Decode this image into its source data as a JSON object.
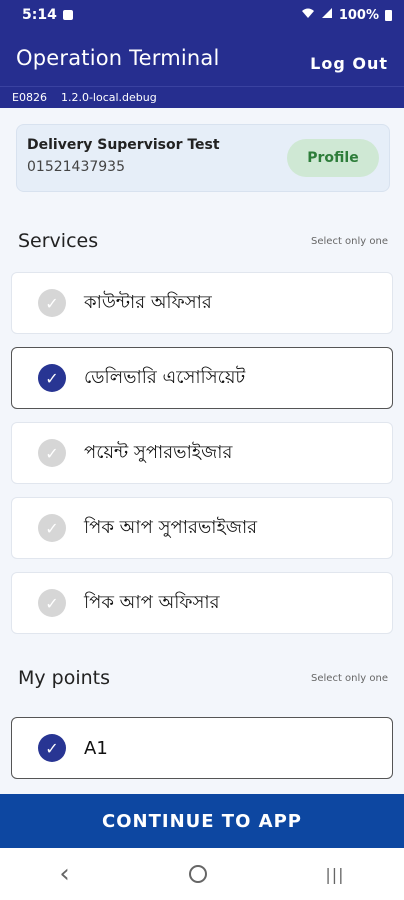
{
  "status_bar": {
    "time": "5:14",
    "battery": "100%"
  },
  "app_bar": {
    "title": "Operation Terminal",
    "logout_label": "Log Out"
  },
  "version": {
    "id": "E0826",
    "build": "1.2.0-local.debug"
  },
  "profile": {
    "name": "Delivery Supervisor Test",
    "phone": "01521437935",
    "button_label": "Profile"
  },
  "services": {
    "title": "Services",
    "hint": "Select only one",
    "items": [
      {
        "label": "কাউন্টার অফিসার",
        "selected": false
      },
      {
        "label": "ডেলিভারি এসোসিয়েট",
        "selected": true
      },
      {
        "label": "পয়েন্ট সুপারভাইজার",
        "selected": false
      },
      {
        "label": "পিক আপ সুপারভাইজার",
        "selected": false
      },
      {
        "label": "পিক আপ অফিসার",
        "selected": false
      }
    ]
  },
  "points": {
    "title": "My points",
    "hint": "Select only one",
    "items": [
      {
        "label": "A1",
        "selected": true
      }
    ]
  },
  "continue_label": "CONTINUE TO APP",
  "colors": {
    "primary": "#262e8f",
    "accent": "#0d47a1",
    "check_on": "#283593",
    "check_off": "#d6d6d6"
  }
}
